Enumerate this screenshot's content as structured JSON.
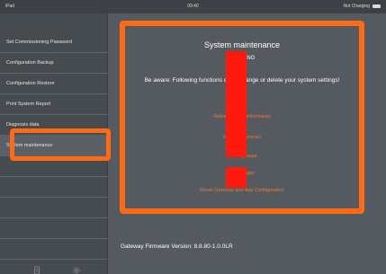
{
  "statusbar": {
    "device": "iPad",
    "time": "09:40",
    "charging": "Not Charging",
    "icons": [
      "wifi-icon",
      "battery-icon"
    ]
  },
  "sidebar": {
    "items": [
      {
        "label": "Set Commissioning Password"
      },
      {
        "label": "Configuration Backup"
      },
      {
        "label": "Configuration Restore"
      },
      {
        "label": "Print System Report"
      },
      {
        "label": "Diagnosis data"
      },
      {
        "label": "System maintenance",
        "selected": true
      }
    ],
    "tab_icons": [
      "document-icon",
      "gear-icon"
    ]
  },
  "panel": {
    "title": "System maintenance",
    "warning": "WARNING",
    "description": "Be aware: Following functions could change or delete your system settings!",
    "actions": [
      {
        "label": "Reload device information"
      },
      {
        "label": "Reset all devices"
      },
      {
        "label": "Reset groups"
      },
      {
        "label": "Reset apps"
      },
      {
        "label": "Reset Gateway and App Configuration"
      }
    ]
  },
  "firmware": {
    "text": "Gateway Firmware Version: 8.8.80-1.0.0LR"
  },
  "colors": {
    "highlight": "#ff6a12",
    "exclamation": "#ff1a10",
    "action_text": "#f07a2a",
    "background": "#555a60",
    "sidebar": "#464b50"
  }
}
